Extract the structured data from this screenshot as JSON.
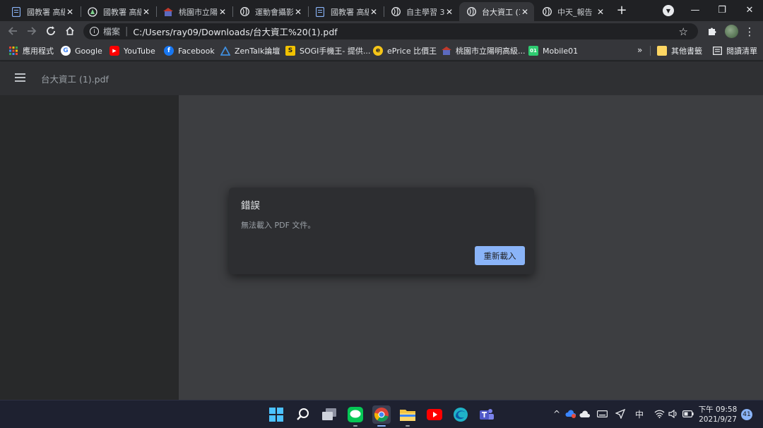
{
  "browser": {
    "tabs": [
      {
        "title": "國教署 高級",
        "icon": "document-icon",
        "active": false
      },
      {
        "title": "國教署 高級",
        "icon": "seal-icon",
        "active": false
      },
      {
        "title": "桃園市立陽",
        "icon": "school-icon",
        "active": false
      },
      {
        "title": "運動會攝影",
        "icon": "globe-icon",
        "active": false
      },
      {
        "title": "國教署 高級",
        "icon": "document-icon",
        "active": false
      },
      {
        "title": "自主學習 3",
        "icon": "globe-icon",
        "active": false
      },
      {
        "title": "台大資工 (1",
        "icon": "globe-icon",
        "active": true
      },
      {
        "title": "中天_報告",
        "icon": "globe-icon",
        "active": false
      }
    ],
    "close_glyph": "✕",
    "new_tab_glyph": "+",
    "window_controls": {
      "minimize": "—",
      "restore": "❐",
      "close": "✕"
    },
    "omnibox": {
      "scheme_label": "檔案",
      "url": "C:/Users/ray09/Downloads/台大資工%20(1).pdf"
    },
    "bookmarks": [
      {
        "label": "應用程式",
        "icon": "apps-grid-icon",
        "icon_color": "#ea4335",
        "glyph": ""
      },
      {
        "label": "Google",
        "icon": "google-icon",
        "icon_color": "#ffffff",
        "glyph": "G"
      },
      {
        "label": "YouTube",
        "icon": "youtube-icon",
        "icon_color": "#ff0000",
        "glyph": "▶"
      },
      {
        "label": "Facebook",
        "icon": "facebook-icon",
        "icon_color": "#1877f2",
        "glyph": "f"
      },
      {
        "label": "ZenTalk論壇",
        "icon": "zentalk-icon",
        "icon_color": "#3f8fe0",
        "glyph": "Z"
      },
      {
        "label": "SOGI手機王- 提供...",
        "icon": "sogi-icon",
        "icon_color": "#f2c200",
        "glyph": "S"
      },
      {
        "label": "ePrice 比價王",
        "icon": "eprice-icon",
        "icon_color": "#f5c518",
        "glyph": "e"
      },
      {
        "label": "桃園市立陽明高級...",
        "icon": "school-icon",
        "icon_color": "#c0392b",
        "glyph": "校"
      },
      {
        "label": "Mobile01",
        "icon": "mobile01-icon",
        "icon_color": "#2ecc71",
        "glyph": "01"
      }
    ],
    "bookmarks_overflow": "»",
    "other_bookmarks": "其他書籤",
    "reading_list": "閱讀清單"
  },
  "pdf_viewer": {
    "title": "台大資工 (1).pdf"
  },
  "dialog": {
    "title": "錯誤",
    "message": "無法載入 PDF 文件。",
    "reload_label": "重新載入"
  },
  "taskbar": {
    "apps": [
      {
        "name": "windows-start",
        "color": "#4cc2ff"
      },
      {
        "name": "search",
        "color": "#ffffff"
      },
      {
        "name": "task-view",
        "color": "#cfd3dc"
      },
      {
        "name": "line",
        "color": "#06c755"
      },
      {
        "name": "chrome",
        "color": "#4285f4"
      },
      {
        "name": "file-explorer",
        "color": "#f4c542"
      },
      {
        "name": "youtube",
        "color": "#ff0000"
      },
      {
        "name": "edge",
        "color": "#1fb3c8"
      },
      {
        "name": "teams",
        "color": "#6264a7"
      }
    ],
    "ime_label": "中",
    "clock_period_time": "下午 09:58",
    "clock_date": "2021/9/27",
    "notification_count": "41"
  }
}
